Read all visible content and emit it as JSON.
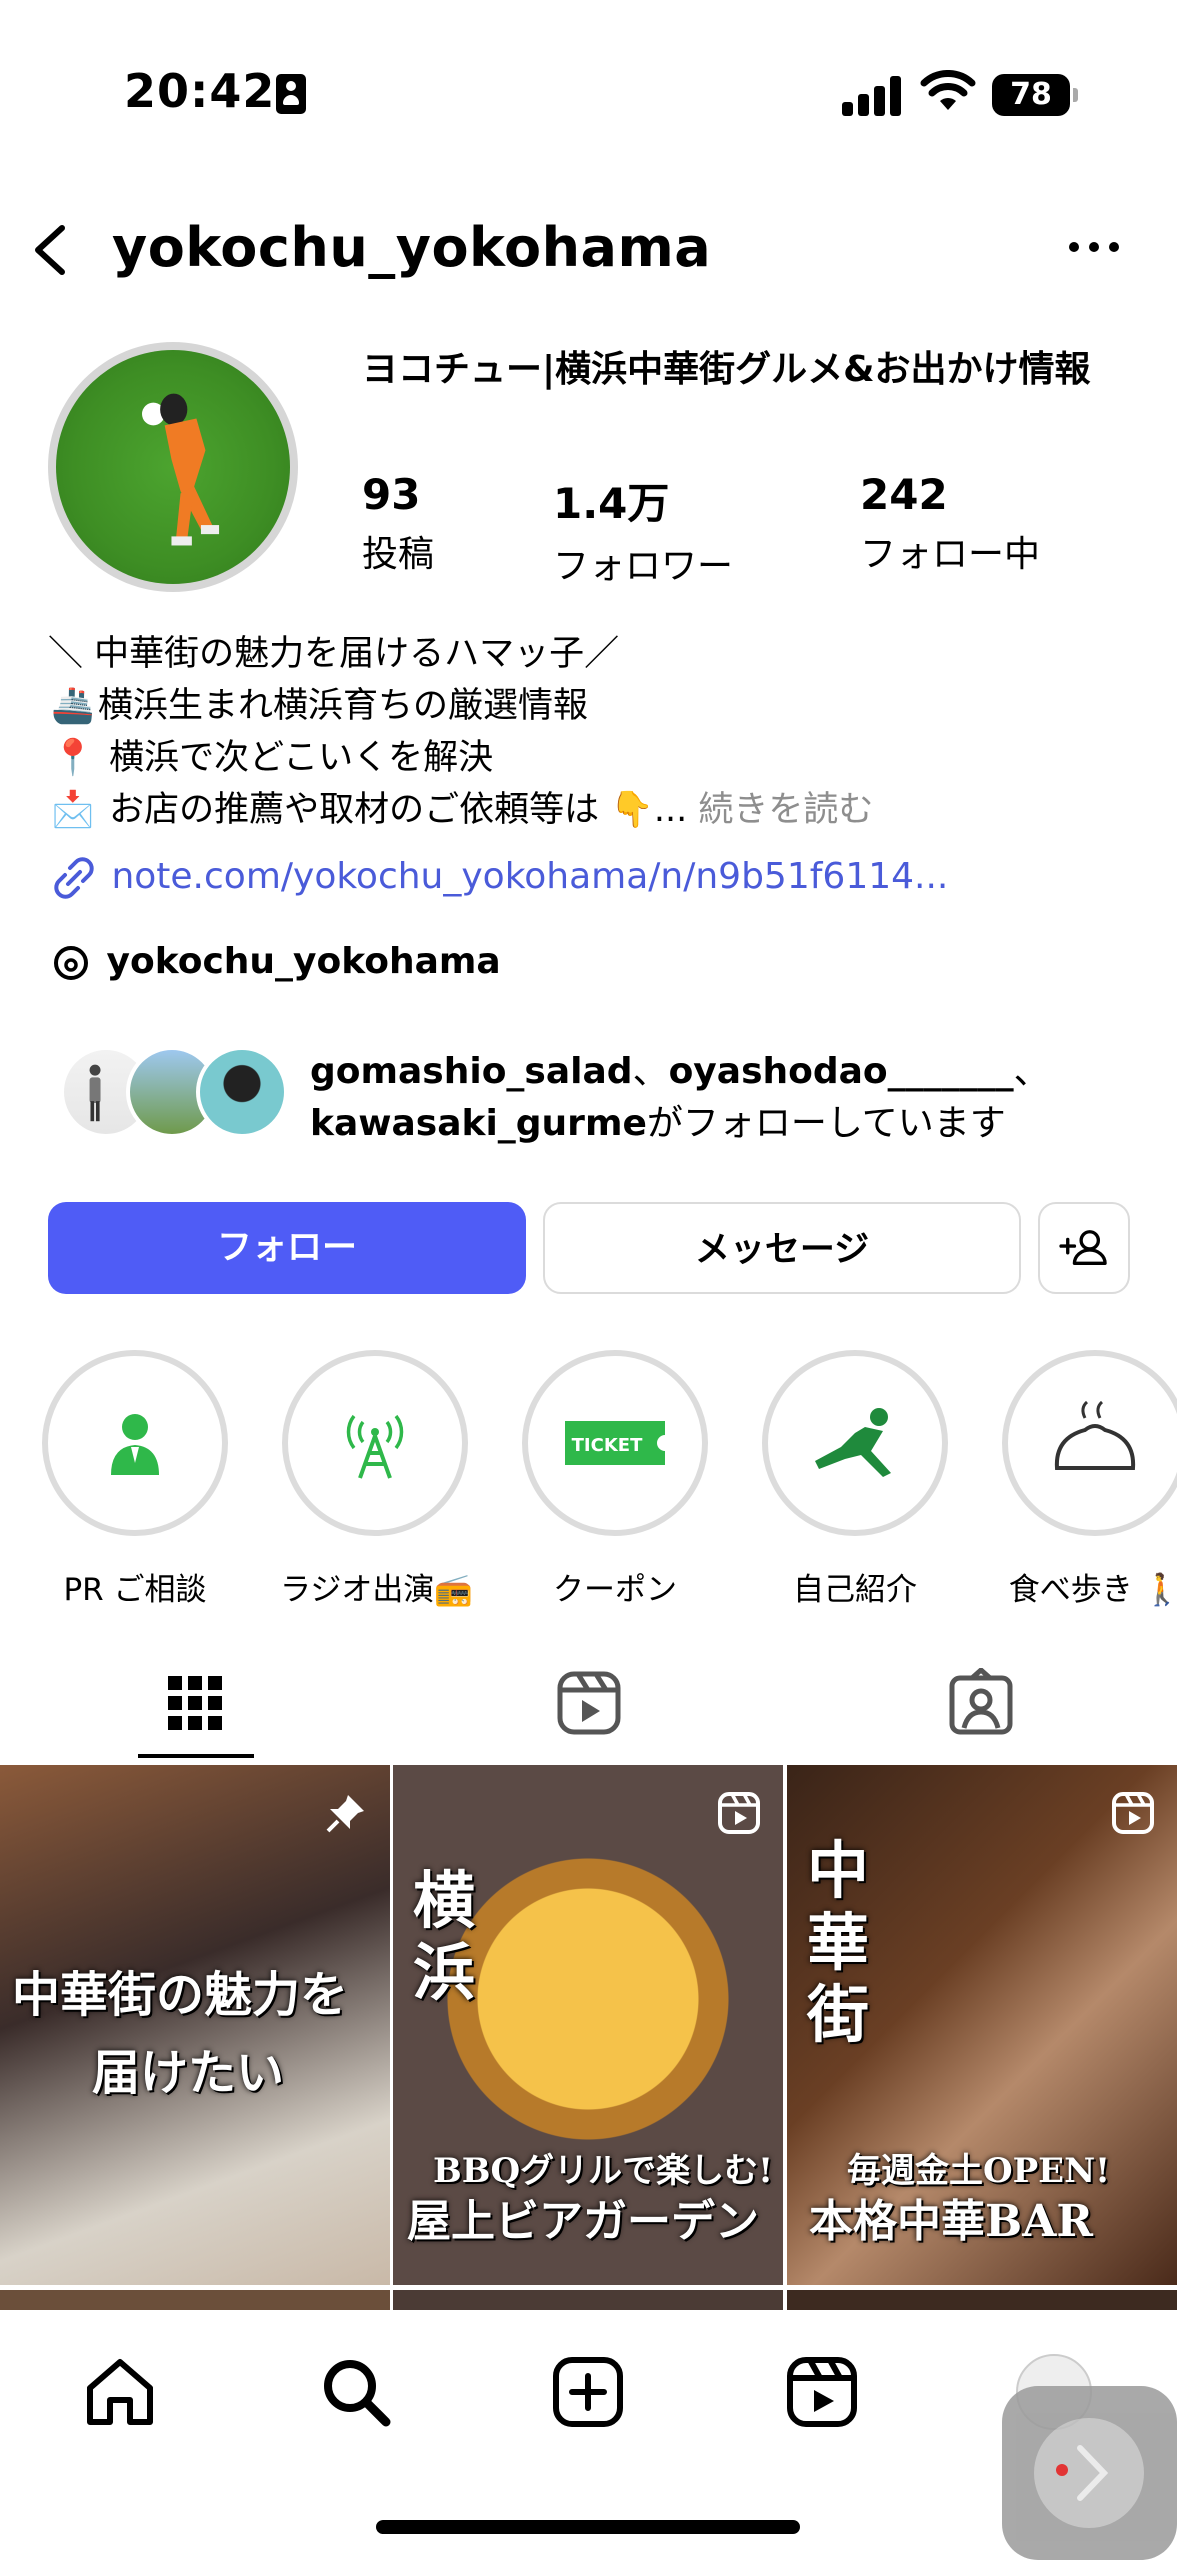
{
  "status_bar": {
    "time": "20:42",
    "battery": "78"
  },
  "header": {
    "username": "yokochu_yokohama"
  },
  "profile": {
    "display_name": "ヨコチュー|横浜中華街グルメ&お出かけ情報",
    "stats": [
      {
        "value": "93",
        "label": "投稿"
      },
      {
        "value": "1.4万",
        "label": "フォロワー"
      },
      {
        "value": "242",
        "label": "フォロー中"
      }
    ],
    "bio": [
      {
        "emoji": "",
        "text": "＼ 中華街の魅力を届けるハマッ子／"
      },
      {
        "emoji": "🚢",
        "text": "横浜生まれ横浜育ちの厳選情報"
      },
      {
        "emoji": "📍",
        "text": " 横浜で次どこいくを解決"
      },
      {
        "emoji": "📩",
        "text": " お店の推薦や取材のご依頼等は 👇..."
      }
    ],
    "more_label": "続きを読む",
    "link": "note.com/yokochu_yokohama/n/n9b51f6114...",
    "threads_handle": "yokochu_yokohama",
    "followed_by": {
      "user1": "gomashio_salad",
      "sep": "、",
      "user2": "oyashodao_______",
      "sep2": "、",
      "user3": "kawasaki_gurme",
      "suffix": "がフォローしています"
    }
  },
  "buttons": {
    "follow": "フォロー",
    "message": "メッセージ"
  },
  "highlights": [
    {
      "label": "PR ご相談",
      "icon": "person-suit-icon"
    },
    {
      "label": "ラジオ出演📻",
      "icon": "antenna-icon"
    },
    {
      "label": "クーポン",
      "icon": "ticket-icon"
    },
    {
      "label": "自己紹介",
      "icon": "kick-figure-icon"
    },
    {
      "label": "食べ歩き 🚶",
      "icon": "bun-icon"
    }
  ],
  "highlight_ticket_text": "TICKET",
  "posts": [
    {
      "text1": "中華街の魅力を",
      "text2": "届けたい"
    },
    {
      "title_vertical": "横浜",
      "sub": "BBQグリルで楽しむ!",
      "main": "屋上ビアガーデン"
    },
    {
      "title_vertical": "中華街",
      "sub": "毎週金土OPEN!",
      "main": "本格中華BAR"
    }
  ],
  "colors": {
    "accent": "#4f5cf6",
    "link": "#4a5bd9",
    "muted": "#8e8e8e"
  }
}
